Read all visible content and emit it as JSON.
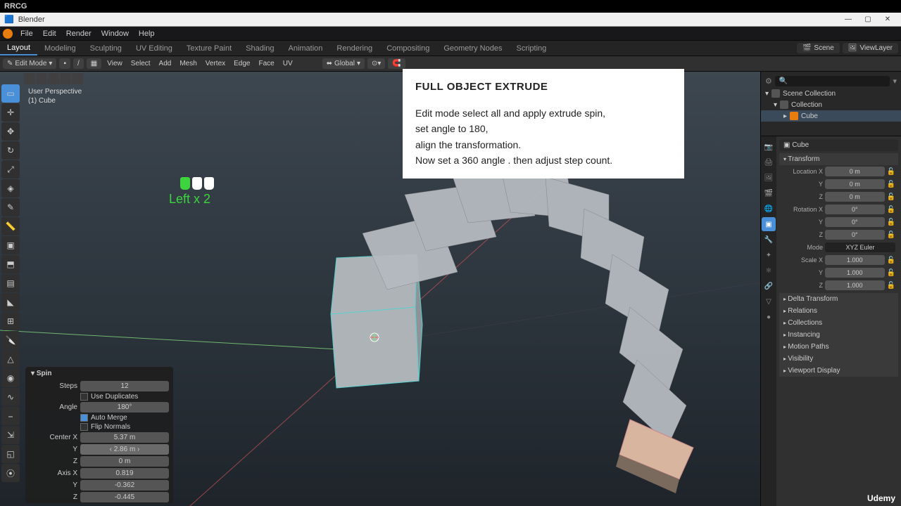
{
  "titlebar_outer": "RRCG",
  "app_title": "Blender",
  "menu": [
    "File",
    "Edit",
    "Render",
    "Window",
    "Help"
  ],
  "workspaces": [
    "Layout",
    "Modeling",
    "Sculpting",
    "UV Editing",
    "Texture Paint",
    "Shading",
    "Animation",
    "Rendering",
    "Compositing",
    "Geometry Nodes",
    "Scripting"
  ],
  "scene_name": "Scene",
  "viewlayer_name": "ViewLayer",
  "editor_header": {
    "mode": "Edit Mode",
    "menus": [
      "View",
      "Select",
      "Add",
      "Mesh",
      "Vertex",
      "Edge",
      "Face",
      "UV"
    ],
    "orientation": "Global"
  },
  "viewport_info": {
    "line1": "User Perspective",
    "line2": "(1) Cube"
  },
  "mouse_overlay": "Left x 2",
  "spin": {
    "title": "Spin",
    "steps_label": "Steps",
    "steps": "12",
    "dupes_label": "Use Duplicates",
    "angle_label": "Angle",
    "angle": "180°",
    "automerge_label": "Auto Merge",
    "flip_label": "Flip Normals",
    "cx_label": "Center X",
    "cx": "5.37 m",
    "cy_label": "Y",
    "cy": "2.86 m",
    "cz_label": "Z",
    "cz": "0 m",
    "ax_label": "Axis X",
    "ax": "0.819",
    "ay_label": "Y",
    "ay": "-0.362",
    "az_label": "Z",
    "az": "-0.445"
  },
  "note": {
    "title": "FULL OBJECT EXTRUDE",
    "l1": "Edit mode select all and apply extrude spin,",
    "l2": "set angle to 180,",
    "l3": "align the transformation.",
    "l4": "Now set a 360 angle . then adjust step count."
  },
  "outliner": {
    "search_placeholder": "",
    "items": [
      "Scene Collection",
      "Collection",
      "Cube"
    ]
  },
  "props": {
    "active_obj": "Cube",
    "panels_open": [
      "Transform"
    ],
    "panels_closed": [
      "Delta Transform",
      "Relations",
      "Collections",
      "Instancing",
      "Motion Paths",
      "Visibility",
      "Viewport Display"
    ],
    "loc_label": "Location X",
    "locx": "0 m",
    "locy": "0 m",
    "locz": "0 m",
    "rot_label": "Rotation X",
    "rotx": "0°",
    "roty": "0°",
    "rotz": "0°",
    "mode_label": "Mode",
    "mode": "XYZ Euler",
    "scale_label": "Scale X",
    "sx": "1.000",
    "sy": "1.000",
    "sz": "1.000",
    "y": "Y",
    "z": "Z"
  },
  "udemy": "Udemy"
}
